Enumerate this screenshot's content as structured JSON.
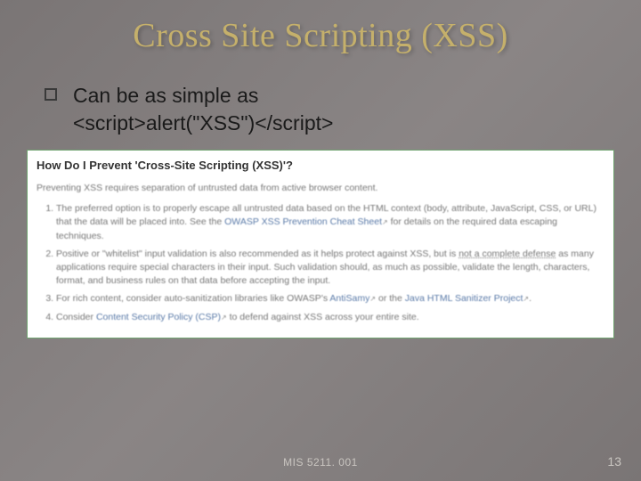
{
  "title": "Cross Site Scripting (XSS)",
  "bullet": {
    "line1": "Can be as simple as",
    "line2": "<script>alert(\"XSS\")</script>"
  },
  "embed": {
    "heading": "How Do I Prevent 'Cross-Site Scripting (XSS)'?",
    "intro": "Preventing XSS requires separation of untrusted data from active browser content.",
    "items": [
      {
        "pre": "The preferred option is to properly escape all untrusted data based on the HTML context (body, attribute, JavaScript, CSS, or URL) that the data will be placed into. See the ",
        "link": "OWASP XSS Prevention Cheat Sheet",
        "post": " for details on the required data escaping techniques."
      },
      {
        "pre": "Positive or \"whitelist\" input validation is also recommended as it helps protect against XSS, but is ",
        "mid_u": "not a complete defense",
        "post": " as many applications require special characters in their input. Such validation should, as much as possible, validate the length, characters, format, and business rules on that data before accepting the input."
      },
      {
        "pre": "For rich content, consider auto-sanitization libraries like OWASP's ",
        "link": "AntiSamy",
        "mid": " or the ",
        "link2": "Java HTML Sanitizer Project",
        "post": "."
      },
      {
        "pre": "Consider ",
        "link": "Content Security Policy (CSP)",
        "post": " to defend against XSS across your entire site."
      }
    ]
  },
  "footer": {
    "center": "MIS 5211. 001",
    "right": "13"
  }
}
